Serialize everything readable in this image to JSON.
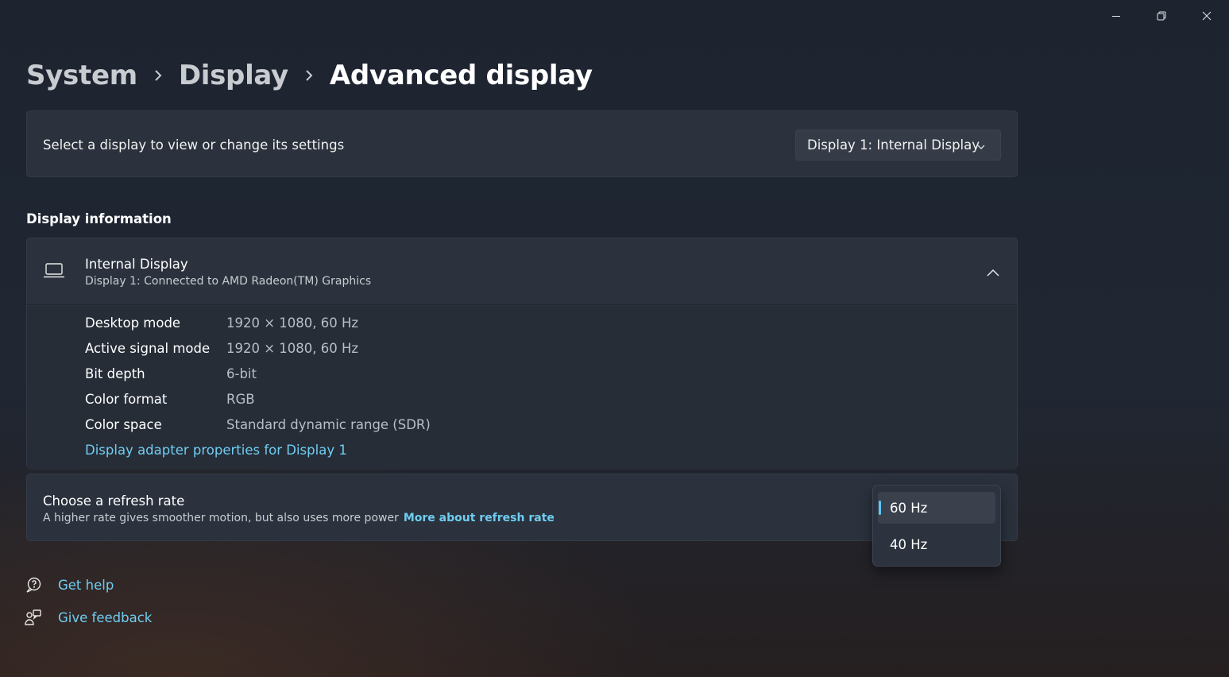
{
  "window": {
    "minimize_icon": "minimize-icon",
    "restore_icon": "restore-icon",
    "close_icon": "close-icon"
  },
  "breadcrumb": {
    "items": [
      "System",
      "Display"
    ],
    "current": "Advanced display"
  },
  "display_select": {
    "label": "Select a display to view or change its settings",
    "selected": "Display 1: Internal Display"
  },
  "display_information": {
    "section_title": "Display information",
    "name": "Internal Display",
    "subtitle": "Display 1: Connected to AMD Radeon(TM) Graphics",
    "expanded": true,
    "rows": [
      {
        "label": "Desktop mode",
        "value": "1920 × 1080, 60 Hz"
      },
      {
        "label": "Active signal mode",
        "value": "1920 × 1080, 60 Hz"
      },
      {
        "label": "Bit depth",
        "value": "6-bit"
      },
      {
        "label": "Color format",
        "value": "RGB"
      },
      {
        "label": "Color space",
        "value": "Standard dynamic range (SDR)"
      }
    ],
    "adapter_link": "Display adapter properties for Display 1"
  },
  "refresh_rate": {
    "title": "Choose a refresh rate",
    "description": "A higher rate gives smoother motion, but also uses more power",
    "more_link": "More about refresh rate",
    "options": [
      "60 Hz",
      "40 Hz"
    ],
    "selected": "60 Hz"
  },
  "footer": {
    "get_help": "Get help",
    "give_feedback": "Give feedback"
  },
  "colors": {
    "accent": "#6fcdf2",
    "selection_indicator": "#5fc6f4",
    "card": "#2b323d"
  }
}
